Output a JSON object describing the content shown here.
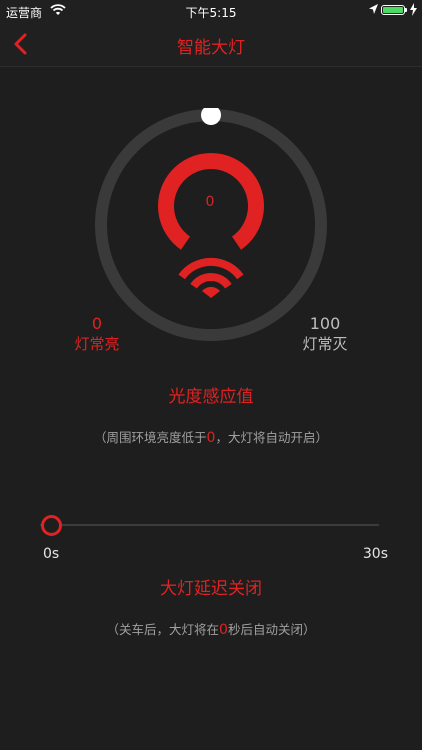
{
  "status_bar": {
    "carrier": "运营商",
    "time": "下午5:15",
    "battery_level": 1.0,
    "icons": [
      "wifi-icon",
      "location-arrow-icon",
      "battery-icon",
      "charging-bolt-icon"
    ]
  },
  "nav": {
    "title": "智能大灯",
    "back_icon": "chevron-left-icon"
  },
  "light_sensor": {
    "value": "0",
    "range_min_value": "0",
    "range_min_label": "灯常亮",
    "range_max_value": "100",
    "range_max_label": "灯常灭",
    "title": "光度感应值",
    "hint_prefix": "（周围环境亮度低于",
    "hint_value": "0",
    "hint_suffix": "，大灯将自动开启）",
    "dial_position": 0.0
  },
  "delay": {
    "min_label": "0s",
    "max_label": "30s",
    "value_fraction": 0.0,
    "title": "大灯延迟关闭",
    "hint_prefix": "（关车后，大灯将在",
    "hint_value": "0",
    "hint_suffix": "秒后自动关闭）"
  },
  "colors": {
    "accent": "#e02222",
    "background": "#1e1e1e",
    "track": "#3b3b3b",
    "muted_text": "#a0a0a0"
  }
}
